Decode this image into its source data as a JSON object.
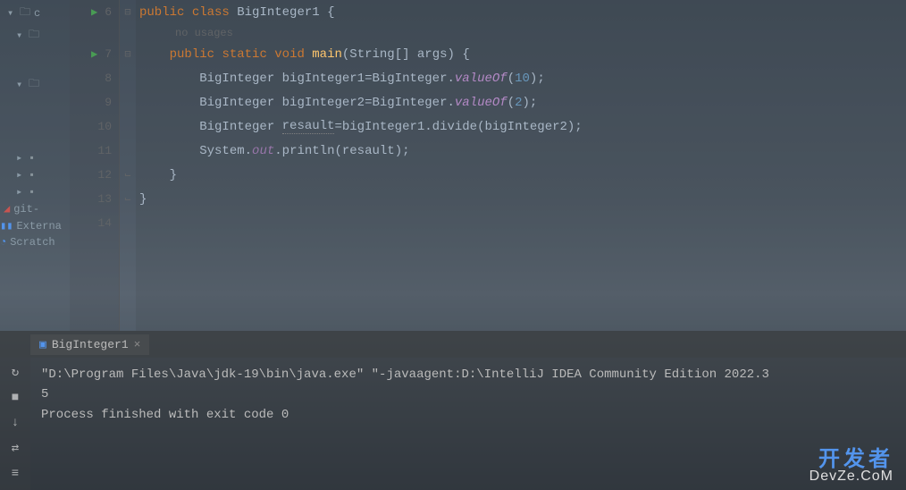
{
  "sidebar": {
    "item0": "c",
    "item5": "git-",
    "item6": "Externa",
    "item7": "Scratch"
  },
  "gutter": {
    "l6": "6",
    "l7": "7",
    "l8": "8",
    "l9": "9",
    "l10": "10",
    "l11": "11",
    "l12": "12",
    "l13": "13",
    "l14": "14"
  },
  "code": {
    "hint": "no usages",
    "l6": {
      "kw1": "public",
      "kw2": "class",
      "name": "BigInteger1",
      "brace": " {"
    },
    "l7": {
      "kw1": "public",
      "kw2": "static",
      "kw3": "void",
      "method": "main",
      "params": "(String[] args) {"
    },
    "l8": {
      "indent": "        ",
      "type": "BigInteger",
      "sp": " ",
      "var": "bigInteger1",
      "eq": "=",
      "cls": "BigInteger",
      "dot": ".",
      "m": "valueOf",
      "open": "(",
      "num": "10",
      "close": ");"
    },
    "l9": {
      "indent": "        ",
      "type": "BigInteger",
      "sp": " ",
      "var": "bigInteger2",
      "eq": "=",
      "cls": "BigInteger",
      "dot": ".",
      "m": "valueOf",
      "open": "(",
      "num": "2",
      "close": ");"
    },
    "l10": {
      "indent": "        ",
      "type": "BigInteger",
      "sp": " ",
      "var": "resault",
      "eq": "=bigInteger1.divide(bigInteger2);"
    },
    "l11": {
      "indent": "        ",
      "sys": "System",
      "dot": ".",
      "out": "out",
      "call": ".println(resault);"
    },
    "l12": "    }",
    "l13": "}"
  },
  "run": {
    "tab": "BigInteger1",
    "line1": "\"D:\\Program Files\\Java\\jdk-19\\bin\\java.exe\" \"-javaagent:D:\\IntelliJ IDEA Community Edition 2022.3",
    "line2": "5",
    "line3": "",
    "line4": "Process finished with exit code 0"
  },
  "watermark": {
    "top": "开发者",
    "bottom": "DevZe.CoM"
  }
}
